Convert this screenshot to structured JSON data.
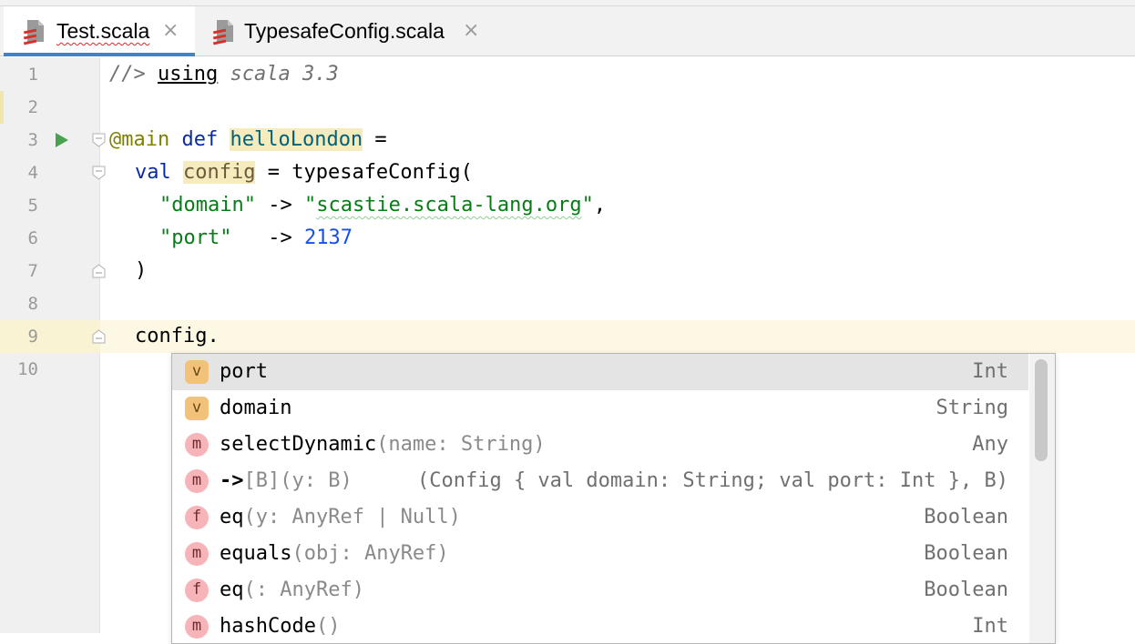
{
  "tabs": [
    {
      "label": "Test.scala",
      "active": true,
      "icon": "scala-file-icon"
    },
    {
      "label": "TypesafeConfig.scala",
      "active": false,
      "icon": "scala-file-icon"
    }
  ],
  "tab_close_glyph": "×",
  "line_numbers": [
    "1",
    "2",
    "3",
    "4",
    "5",
    "6",
    "7",
    "8",
    "9",
    "10"
  ],
  "code": {
    "l1": {
      "comment": "//>",
      "using": "using",
      "rest": " scala 3.3"
    },
    "l3": {
      "anno": "@main",
      "kw": "def",
      "name": "helloLondon",
      "rest": " ="
    },
    "l4": {
      "kw": "val",
      "name": "config",
      "rest": " = typesafeConfig("
    },
    "l5": {
      "key": "\"domain\"",
      "arrow": " -> ",
      "q1": "\"",
      "value": "scastie.scala-lang.org",
      "q2": "\"",
      "rest": ","
    },
    "l6": {
      "key": "\"port\"",
      "arrow": "   -> ",
      "value": "2137"
    },
    "l7": {
      "text": ")"
    },
    "l9": {
      "text": "config."
    }
  },
  "completion": {
    "items": [
      {
        "kind": "v",
        "name": "port",
        "tail": "",
        "type": "Int",
        "selected": true
      },
      {
        "kind": "v",
        "name": "domain",
        "tail": "",
        "type": "String",
        "selected": false
      },
      {
        "kind": "m",
        "name": "selectDynamic",
        "tail": "(name: String)",
        "type": "Any",
        "selected": false
      },
      {
        "kind": "m",
        "name": "->",
        "tail": "[B](y: B)",
        "type": "(Config { val domain: String; val port: Int }, B)",
        "selected": false
      },
      {
        "kind": "f",
        "name": "eq",
        "tail": "(y: AnyRef | Null)",
        "type": "Boolean",
        "selected": false
      },
      {
        "kind": "m",
        "name": "equals",
        "tail": "(obj: AnyRef)",
        "type": "Boolean",
        "selected": false
      },
      {
        "kind": "f",
        "name": "eq",
        "tail": "(: AnyRef)",
        "type": "Boolean",
        "selected": false
      },
      {
        "kind": "m",
        "name": "hashCode",
        "tail": "()",
        "type": "Int",
        "selected": false
      }
    ]
  },
  "colors": {
    "accent_tab": "#4083c9",
    "keyword": "#0a2ba3",
    "string": "#067d17",
    "number": "#1750eb",
    "annotation": "#808000"
  }
}
